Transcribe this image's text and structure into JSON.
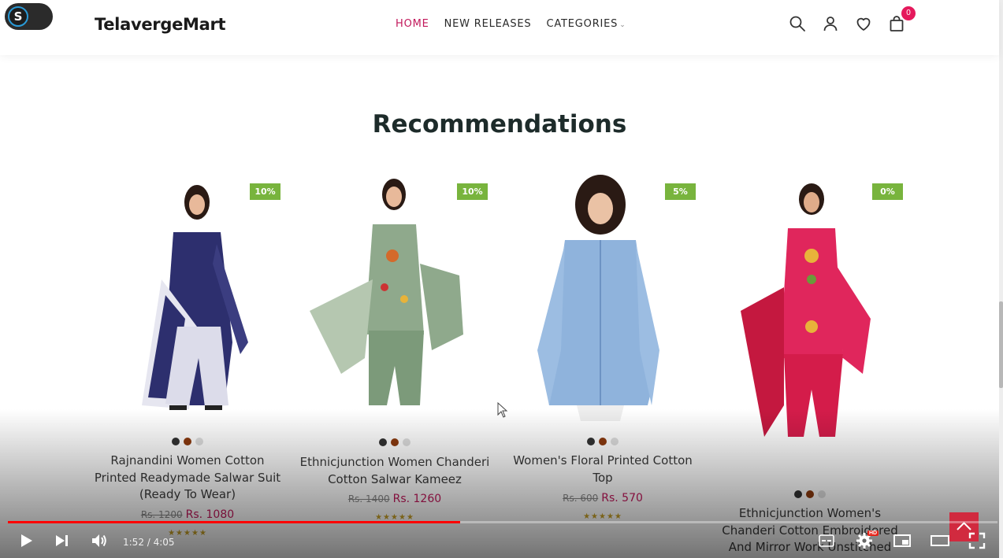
{
  "header": {
    "logo": "TelavergeMart",
    "nav": [
      {
        "label": "HOME",
        "active": true
      },
      {
        "label": "NEW RELEASES",
        "active": false
      },
      {
        "label": "CATEGORIES",
        "active": false,
        "has_dropdown": true
      }
    ],
    "cart_count": "0",
    "extension_toggle_letter": "S"
  },
  "section": {
    "title": "Recommendations"
  },
  "products": [
    {
      "discount": "10%",
      "name": "Rajnandini Women Cotton Printed Readymade Salwar Suit (Ready To Wear)",
      "old_price": "Rs. 1200",
      "price": "Rs. 1080",
      "swatches": [
        "#333333",
        "#8b3a0f",
        "#dddddd"
      ],
      "rating": 5
    },
    {
      "discount": "10%",
      "name": "Ethnicjunction Women Chanderi Cotton Salwar Kameez",
      "old_price": "Rs. 1400",
      "price": "Rs. 1260",
      "swatches": [
        "#333333",
        "#8b3a0f",
        "#dddddd"
      ],
      "rating": 5
    },
    {
      "discount": "5%",
      "name": "Women's Floral Printed Cotton Top",
      "old_price": "Rs. 600",
      "price": "Rs. 570",
      "swatches": [
        "#333333",
        "#8b3a0f",
        "#dddddd"
      ],
      "rating": 5
    },
    {
      "discount": "0%",
      "name": "Ethnicjunction Women's Chanderi Cotton Embroidered And Mirror Work Unstitched",
      "swatches": [
        "#333333",
        "#8b3a0f",
        "#dddddd"
      ]
    }
  ],
  "video_player": {
    "time": "1:52 / 4:05",
    "progress": 0.457,
    "quality_badge": "HD"
  },
  "colors": {
    "accent": "#c2185b",
    "discount_badge": "#78b43d",
    "back_to_top": "#d12a3f",
    "progress_played": "#ff0000"
  }
}
